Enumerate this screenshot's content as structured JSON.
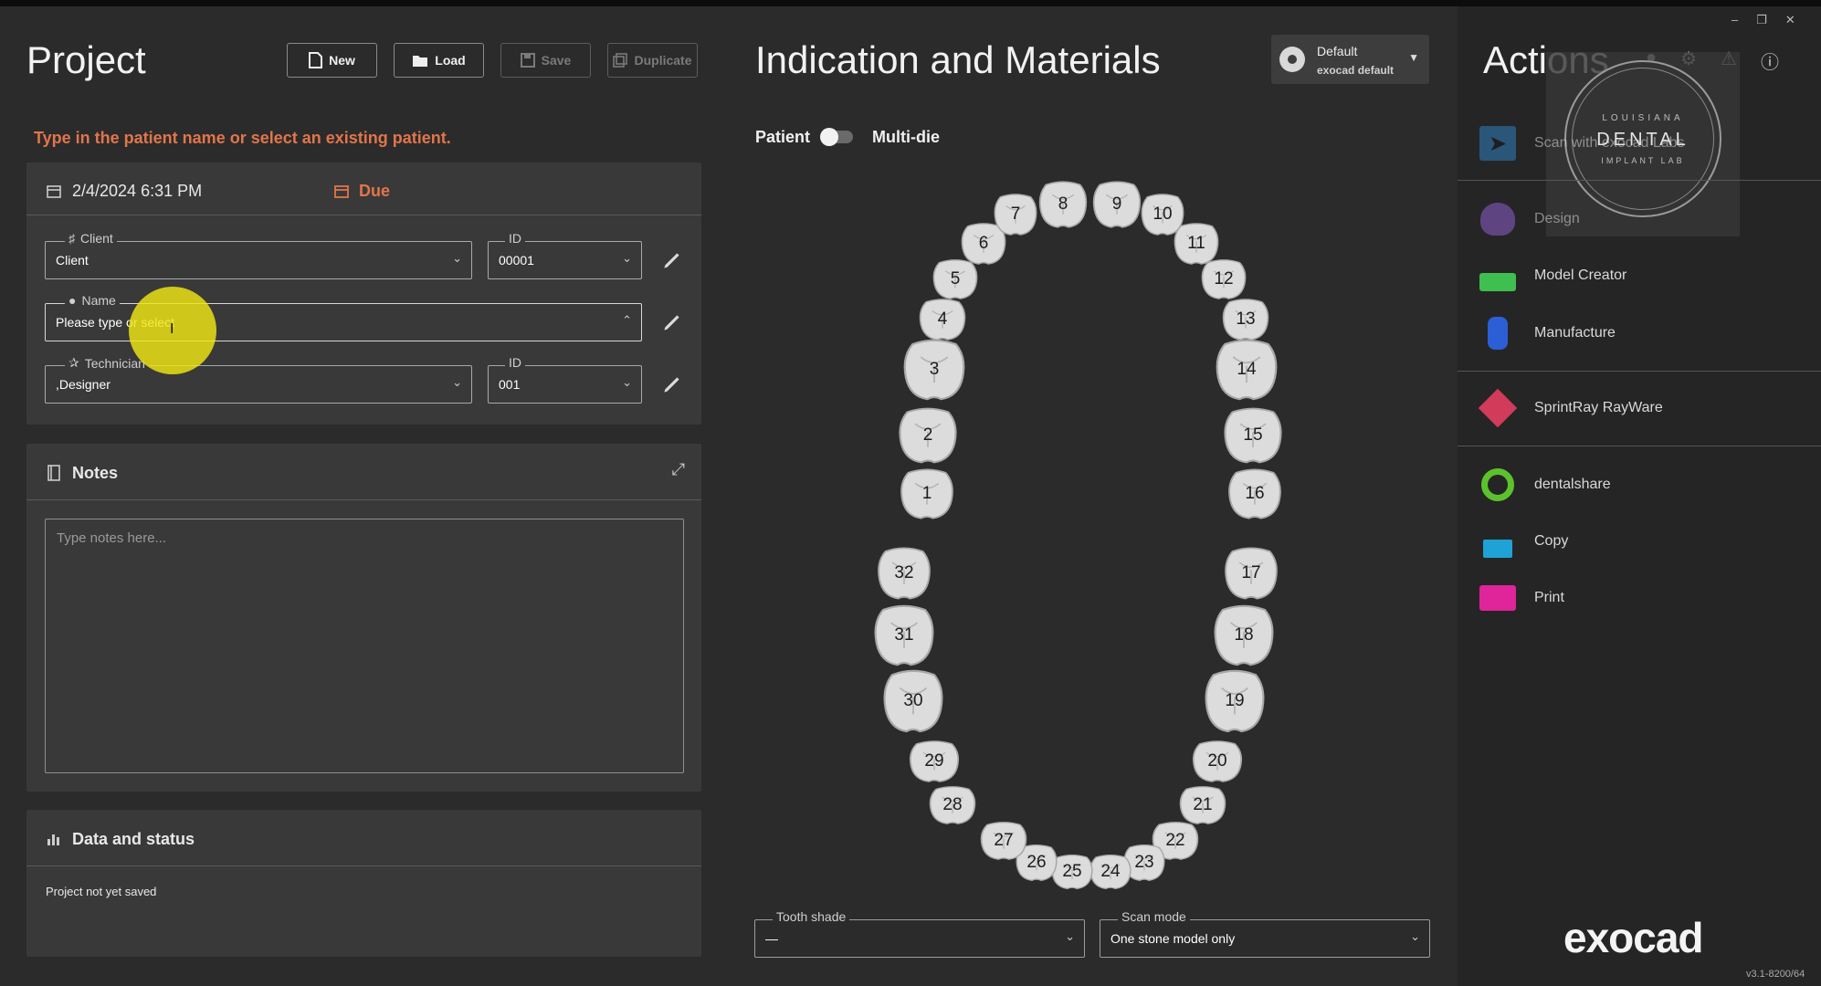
{
  "project": {
    "title": "Project",
    "buttons": {
      "new": "New",
      "load": "Load",
      "save": "Save",
      "duplicate": "Duplicate"
    },
    "hint": "Type in the patient name or select an existing patient.",
    "date": "2/4/2024 6:31 PM",
    "due": "Due",
    "client": {
      "label": "Client",
      "value": "Client",
      "id_label": "ID",
      "id_value": "00001"
    },
    "name": {
      "label": "Name",
      "placeholder": "Please type or select"
    },
    "technician": {
      "label": "Technician",
      "value": ",Designer",
      "id_label": "ID",
      "id_value": "001"
    }
  },
  "notes": {
    "title": "Notes",
    "placeholder": "Type notes here..."
  },
  "data_status": {
    "title": "Data and status",
    "text": "Project not yet saved"
  },
  "indication": {
    "title": "Indication and Materials",
    "profile": {
      "name": "Default",
      "sub": "exocad default"
    },
    "toggle_left": "Patient",
    "toggle_right": "Multi-die",
    "tooth_shade": {
      "label": "Tooth shade",
      "value": "—"
    },
    "scan_mode": {
      "label": "Scan mode",
      "value": "One stone model only"
    },
    "teeth": [
      "1",
      "2",
      "3",
      "4",
      "5",
      "6",
      "7",
      "8",
      "9",
      "10",
      "11",
      "12",
      "13",
      "14",
      "15",
      "16",
      "17",
      "18",
      "19",
      "20",
      "21",
      "22",
      "23",
      "24",
      "25",
      "26",
      "27",
      "28",
      "29",
      "30",
      "31",
      "32"
    ]
  },
  "actions": {
    "title": "Actions",
    "watermark": {
      "top": "LOUISIANA",
      "main": "DENTAL",
      "bottom": "IMPLANT LAB"
    },
    "items": [
      {
        "label": "Scan with exocad Labs",
        "color": "#2f7fc1",
        "icon": "scan-icon"
      },
      {
        "label": "Design",
        "color": "#8f5fd0",
        "icon": "tooth-design-icon"
      },
      {
        "label": "Model Creator",
        "color": "#3fbf4f",
        "icon": "model-creator-icon"
      },
      {
        "label": "Manufacture",
        "color": "#2c5fd6",
        "icon": "manufacture-icon"
      },
      {
        "label": "SprintRay RayWare",
        "color": "#d23b5a",
        "icon": "sprintray-icon"
      },
      {
        "label": "dentalshare",
        "color": "#5cc22c",
        "icon": "dentalshare-icon"
      },
      {
        "label": "Copy",
        "color": "#1fa2d6",
        "icon": "copy-icon"
      },
      {
        "label": "Print",
        "color": "#e0249a",
        "icon": "print-icon"
      }
    ],
    "logo": "exocad",
    "version": "v3.1-8200/64"
  }
}
